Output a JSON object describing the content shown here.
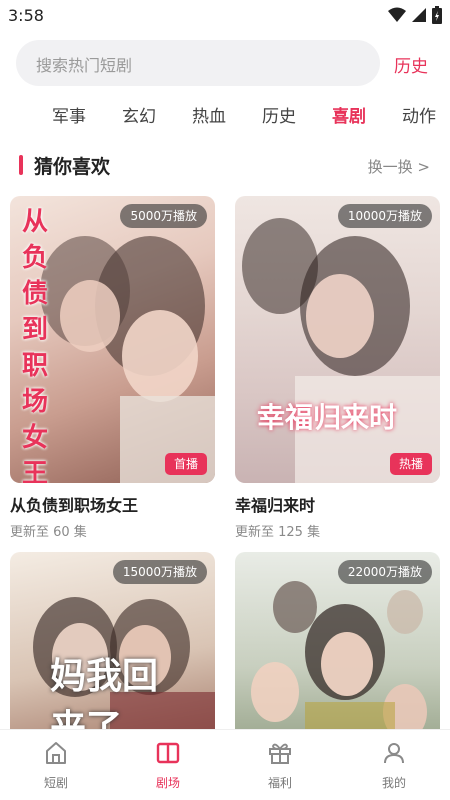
{
  "status_bar": {
    "time": "3:58"
  },
  "search": {
    "placeholder": "搜索热门短剧",
    "history_label": "历史"
  },
  "tabs": [
    {
      "label": "军事"
    },
    {
      "label": "玄幻"
    },
    {
      "label": "热血"
    },
    {
      "label": "历史"
    },
    {
      "label": "喜剧"
    },
    {
      "label": "动作"
    }
  ],
  "section": {
    "title": "猜你喜欢",
    "more": "换一换 >"
  },
  "cards": [
    {
      "title": "从负债到职场女王",
      "episodes": "更新至 60 集",
      "plays": "5000万播放",
      "badge": "首播",
      "poster_text": "从负债到职场女王"
    },
    {
      "title": "幸福归来时",
      "episodes": "更新至 125 集",
      "plays": "10000万播放",
      "badge": "热播",
      "poster_text": "幸福归来时"
    },
    {
      "title": "",
      "episodes": "",
      "plays": "15000万播放",
      "badge": "",
      "poster_text": "妈我回来了"
    },
    {
      "title": "",
      "episodes": "",
      "plays": "22000万播放",
      "badge": "",
      "poster_text": ""
    }
  ],
  "nav": [
    {
      "label": "短剧",
      "icon": "home-icon"
    },
    {
      "label": "剧场",
      "icon": "theater-icon"
    },
    {
      "label": "福利",
      "icon": "gift-icon"
    },
    {
      "label": "我的",
      "icon": "user-icon"
    }
  ],
  "colors": {
    "accent": "#e8335a"
  }
}
